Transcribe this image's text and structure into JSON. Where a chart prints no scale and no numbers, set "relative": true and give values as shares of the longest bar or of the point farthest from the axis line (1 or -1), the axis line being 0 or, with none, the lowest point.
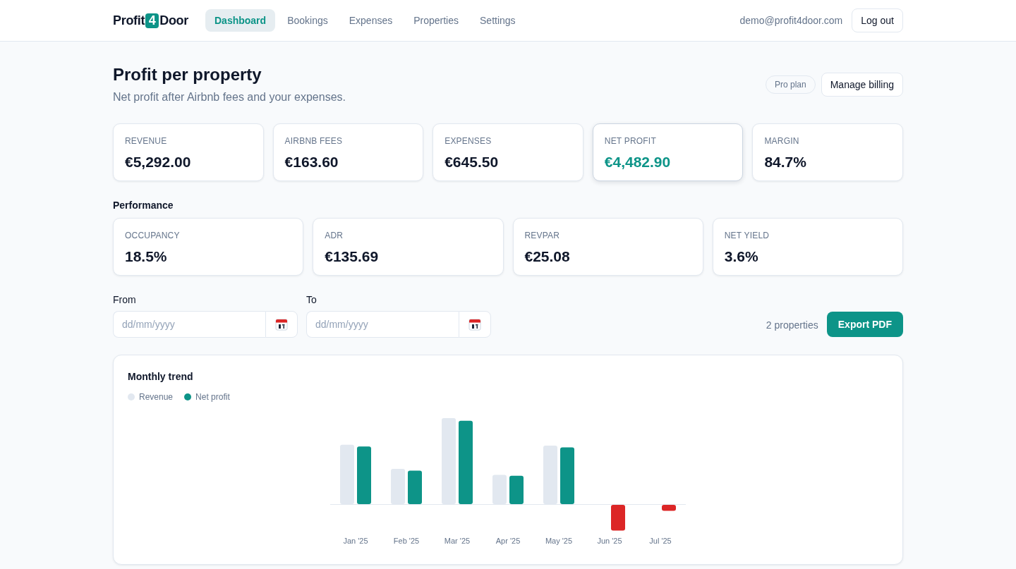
{
  "header": {
    "logo": {
      "text_before": "Profit",
      "badge": "4",
      "text_after": "Door"
    },
    "nav": [
      {
        "label": "Dashboard",
        "selected": true
      },
      {
        "label": "Bookings",
        "selected": false
      },
      {
        "label": "Expenses",
        "selected": false
      },
      {
        "label": "Properties",
        "selected": false
      },
      {
        "label": "Settings",
        "selected": false
      }
    ],
    "user_email": "demo@profit4door.com",
    "logout_button": "Log out"
  },
  "page": {
    "title": "Profit per property",
    "subtitle": "Net profit after Airbnb fees and your expenses.",
    "plan_badge": "Pro plan",
    "billing_button": "Manage billing"
  },
  "summary_cards": [
    {
      "label": "REVENUE",
      "value": "€5,292.00",
      "highlighted": false
    },
    {
      "label": "AIRBNB FEES",
      "value": "€163.60",
      "highlighted": false
    },
    {
      "label": "EXPENSES",
      "value": "€645.50",
      "highlighted": false
    },
    {
      "label": "NET PROFIT",
      "value": "€4,482.90",
      "highlighted": true
    },
    {
      "label": "MARGIN",
      "value": "84.7%",
      "highlighted": false
    }
  ],
  "performance": {
    "title": "Performance",
    "cards": [
      {
        "label": "OCCUPANCY",
        "value": "18.5%"
      },
      {
        "label": "ADR",
        "value": "€135.69"
      },
      {
        "label": "REVPAR",
        "value": "€25.08"
      },
      {
        "label": "NET YIELD",
        "value": "3.6%"
      }
    ]
  },
  "filters": {
    "fields": [
      {
        "label": "From",
        "placeholder": "dd/mm/yyyy"
      },
      {
        "label": "To",
        "placeholder": "dd/mm/yyyy"
      }
    ],
    "property_count": "2 properties",
    "export_button": "Export PDF"
  },
  "trend": {
    "chart_data": {
      "type": "bar",
      "title": "Monthly trend",
      "relative": true,
      "categories": [
        "Jan '25",
        "Feb '25",
        "Mar '25",
        "Apr '25",
        "May '25",
        "Jun '25",
        "Jul '25"
      ],
      "series": [
        {
          "name": "Revenue",
          "color": "#e2e8f0",
          "values": [
            0.69,
            0.41,
            1,
            0.34,
            0.68,
            0,
            0
          ]
        },
        {
          "name": "Net profit",
          "color": "#0d9488",
          "values": [
            0.67,
            0.39,
            0.97,
            0.33,
            0.66,
            0,
            0
          ]
        },
        {
          "color": "#dc2626",
          "values": [
            0,
            0,
            0,
            0,
            0,
            -0.3,
            -0.07
          ]
        }
      ]
    }
  }
}
